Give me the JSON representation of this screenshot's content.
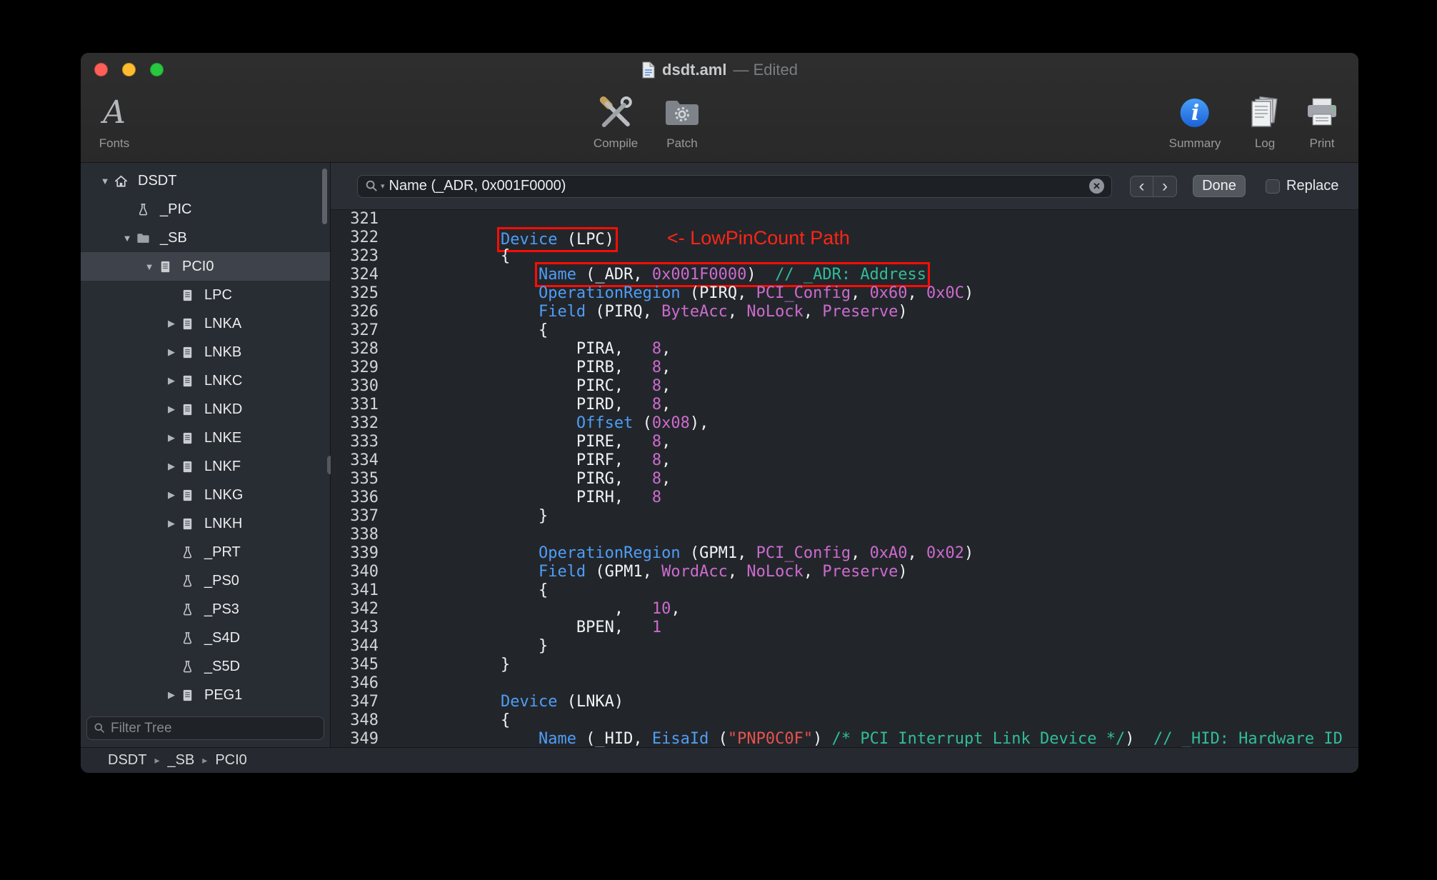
{
  "window": {
    "title": "dsdt.aml",
    "edited_suffix": "— Edited"
  },
  "toolbar": {
    "fonts": "Fonts",
    "compile": "Compile",
    "patch": "Patch",
    "summary": "Summary",
    "log": "Log",
    "print": "Print"
  },
  "sidebar": {
    "filter_placeholder": "Filter Tree",
    "tree": [
      {
        "label": "DSDT",
        "level": 0,
        "disclosure": "open",
        "icon": "home",
        "selected": false
      },
      {
        "label": "_PIC",
        "level": 1,
        "disclosure": "none",
        "icon": "method",
        "selected": false
      },
      {
        "label": "_SB",
        "level": 1,
        "disclosure": "open",
        "icon": "folder",
        "selected": false
      },
      {
        "label": "PCI0",
        "level": 2,
        "disclosure": "open",
        "icon": "document",
        "selected": true
      },
      {
        "label": "LPC",
        "level": 3,
        "disclosure": "none",
        "icon": "document",
        "selected": false
      },
      {
        "label": "LNKA",
        "level": 3,
        "disclosure": "closed",
        "icon": "document",
        "selected": false
      },
      {
        "label": "LNKB",
        "level": 3,
        "disclosure": "closed",
        "icon": "document",
        "selected": false
      },
      {
        "label": "LNKC",
        "level": 3,
        "disclosure": "closed",
        "icon": "document",
        "selected": false
      },
      {
        "label": "LNKD",
        "level": 3,
        "disclosure": "closed",
        "icon": "document",
        "selected": false
      },
      {
        "label": "LNKE",
        "level": 3,
        "disclosure": "closed",
        "icon": "document",
        "selected": false
      },
      {
        "label": "LNKF",
        "level": 3,
        "disclosure": "closed",
        "icon": "document",
        "selected": false
      },
      {
        "label": "LNKG",
        "level": 3,
        "disclosure": "closed",
        "icon": "document",
        "selected": false
      },
      {
        "label": "LNKH",
        "level": 3,
        "disclosure": "closed",
        "icon": "document",
        "selected": false
      },
      {
        "label": "_PRT",
        "level": 3,
        "disclosure": "none",
        "icon": "method",
        "selected": false
      },
      {
        "label": "_PS0",
        "level": 3,
        "disclosure": "none",
        "icon": "method",
        "selected": false
      },
      {
        "label": "_PS3",
        "level": 3,
        "disclosure": "none",
        "icon": "method",
        "selected": false
      },
      {
        "label": "_S4D",
        "level": 3,
        "disclosure": "none",
        "icon": "method",
        "selected": false
      },
      {
        "label": "_S5D",
        "level": 3,
        "disclosure": "none",
        "icon": "method",
        "selected": false
      },
      {
        "label": "PEG1",
        "level": 3,
        "disclosure": "closed",
        "icon": "document",
        "selected": false
      }
    ]
  },
  "findbar": {
    "query": "Name (_ADR, 0x001F0000)",
    "done": "Done",
    "replace": "Replace",
    "replace_checked": false
  },
  "breadcrumb": [
    "DSDT",
    "_SB",
    "PCI0"
  ],
  "editor": {
    "first_line": 321,
    "lines": [
      [],
      [
        [
          "        "
        ],
        [
          "Device",
          "k",
          1
        ],
        [
          " (LPC)",
          "",
          1
        ],
        [
          "<- LowPinCount Path",
          "anno"
        ]
      ],
      [
        [
          "        {"
        ]
      ],
      [
        [
          "            "
        ],
        [
          "Name",
          "k",
          1
        ],
        [
          " (_ADR, ",
          "",
          1
        ],
        [
          "0x001F0000",
          "n",
          1
        ],
        [
          ")  ",
          "",
          1
        ],
        [
          "// _ADR: Address",
          "c",
          1
        ]
      ],
      [
        [
          "            "
        ],
        [
          "OperationRegion",
          "k"
        ],
        [
          " (PIRQ, "
        ],
        [
          "PCI_Config",
          "n"
        ],
        [
          ", "
        ],
        [
          "0x60",
          "n"
        ],
        [
          ", "
        ],
        [
          "0x0C",
          "n"
        ],
        [
          ")"
        ]
      ],
      [
        [
          "            "
        ],
        [
          "Field",
          "k"
        ],
        [
          " (PIRQ, "
        ],
        [
          "ByteAcc",
          "n"
        ],
        [
          ", "
        ],
        [
          "NoLock",
          "n"
        ],
        [
          ", "
        ],
        [
          "Preserve",
          "n"
        ],
        [
          ")"
        ]
      ],
      [
        [
          "            {"
        ]
      ],
      [
        [
          "                PIRA,   "
        ],
        [
          "8",
          "n"
        ],
        [
          ","
        ]
      ],
      [
        [
          "                PIRB,   "
        ],
        [
          "8",
          "n"
        ],
        [
          ","
        ]
      ],
      [
        [
          "                PIRC,   "
        ],
        [
          "8",
          "n"
        ],
        [
          ","
        ]
      ],
      [
        [
          "                PIRD,   "
        ],
        [
          "8",
          "n"
        ],
        [
          ","
        ]
      ],
      [
        [
          "                "
        ],
        [
          "Offset",
          "k"
        ],
        [
          " ("
        ],
        [
          "0x08",
          "n"
        ],
        [
          "),"
        ]
      ],
      [
        [
          "                PIRE,   "
        ],
        [
          "8",
          "n"
        ],
        [
          ","
        ]
      ],
      [
        [
          "                PIRF,   "
        ],
        [
          "8",
          "n"
        ],
        [
          ","
        ]
      ],
      [
        [
          "                PIRG,   "
        ],
        [
          "8",
          "n"
        ],
        [
          ","
        ]
      ],
      [
        [
          "                PIRH,   "
        ],
        [
          "8",
          "n"
        ]
      ],
      [
        [
          "            }"
        ]
      ],
      [],
      [
        [
          "            "
        ],
        [
          "OperationRegion",
          "k"
        ],
        [
          " (GPM1, "
        ],
        [
          "PCI_Config",
          "n"
        ],
        [
          ", "
        ],
        [
          "0xA0",
          "n"
        ],
        [
          ", "
        ],
        [
          "0x02",
          "n"
        ],
        [
          ")"
        ]
      ],
      [
        [
          "            "
        ],
        [
          "Field",
          "k"
        ],
        [
          " (GPM1, "
        ],
        [
          "WordAcc",
          "n"
        ],
        [
          ", "
        ],
        [
          "NoLock",
          "n"
        ],
        [
          ", "
        ],
        [
          "Preserve",
          "n"
        ],
        [
          ")"
        ]
      ],
      [
        [
          "            {"
        ]
      ],
      [
        [
          "                    ,   "
        ],
        [
          "10",
          "n"
        ],
        [
          ","
        ]
      ],
      [
        [
          "                BPEN,   "
        ],
        [
          "1",
          "n"
        ]
      ],
      [
        [
          "            }"
        ]
      ],
      [
        [
          "        }"
        ]
      ],
      [],
      [
        [
          "        "
        ],
        [
          "Device",
          "k"
        ],
        [
          " (LNKA)"
        ]
      ],
      [
        [
          "        {"
        ]
      ],
      [
        [
          "            "
        ],
        [
          "Name",
          "k"
        ],
        [
          " (_HID, "
        ],
        [
          "EisaId",
          "k"
        ],
        [
          " ("
        ],
        [
          "\"PNP0C0F\"",
          "s"
        ],
        [
          ") "
        ],
        [
          "/* PCI Interrupt Link Device */",
          "c"
        ],
        [
          ")  "
        ],
        [
          "// _HID: Hardware ID",
          "c"
        ]
      ]
    ]
  },
  "colors": {
    "keyword": "#4f9df5",
    "constant": "#cd6bcd",
    "comment": "#31bc9a",
    "string": "#e8524e",
    "annotation_text": "#fd2415",
    "annotation_box": "#fb0d05",
    "selection": "#3e434b"
  }
}
